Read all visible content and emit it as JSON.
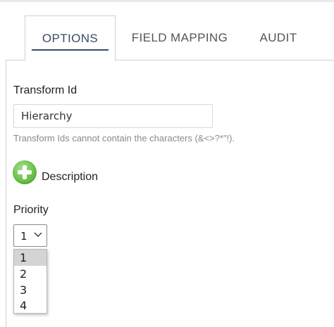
{
  "tabs": [
    {
      "label": "OPTIONS",
      "active": true
    },
    {
      "label": "FIELD MAPPING",
      "active": false
    },
    {
      "label": "AUDIT",
      "active": false
    }
  ],
  "form": {
    "transform_id_label": "Transform Id",
    "transform_id_value": "Hierarchy",
    "transform_id_hint": "Transform Ids cannot contain the characters (&<>?*\"!).",
    "add_description_icon": "plus-circle-icon",
    "description_label": "Description",
    "priority_label": "Priority",
    "priority_selected": "1",
    "priority_options": [
      "1",
      "2",
      "3",
      "4"
    ]
  },
  "colors": {
    "accent": "#3b4c63",
    "add_icon": "#6cc24a",
    "hint_text": "#8a8a8a",
    "option_highlight": "#d4d4d4"
  }
}
